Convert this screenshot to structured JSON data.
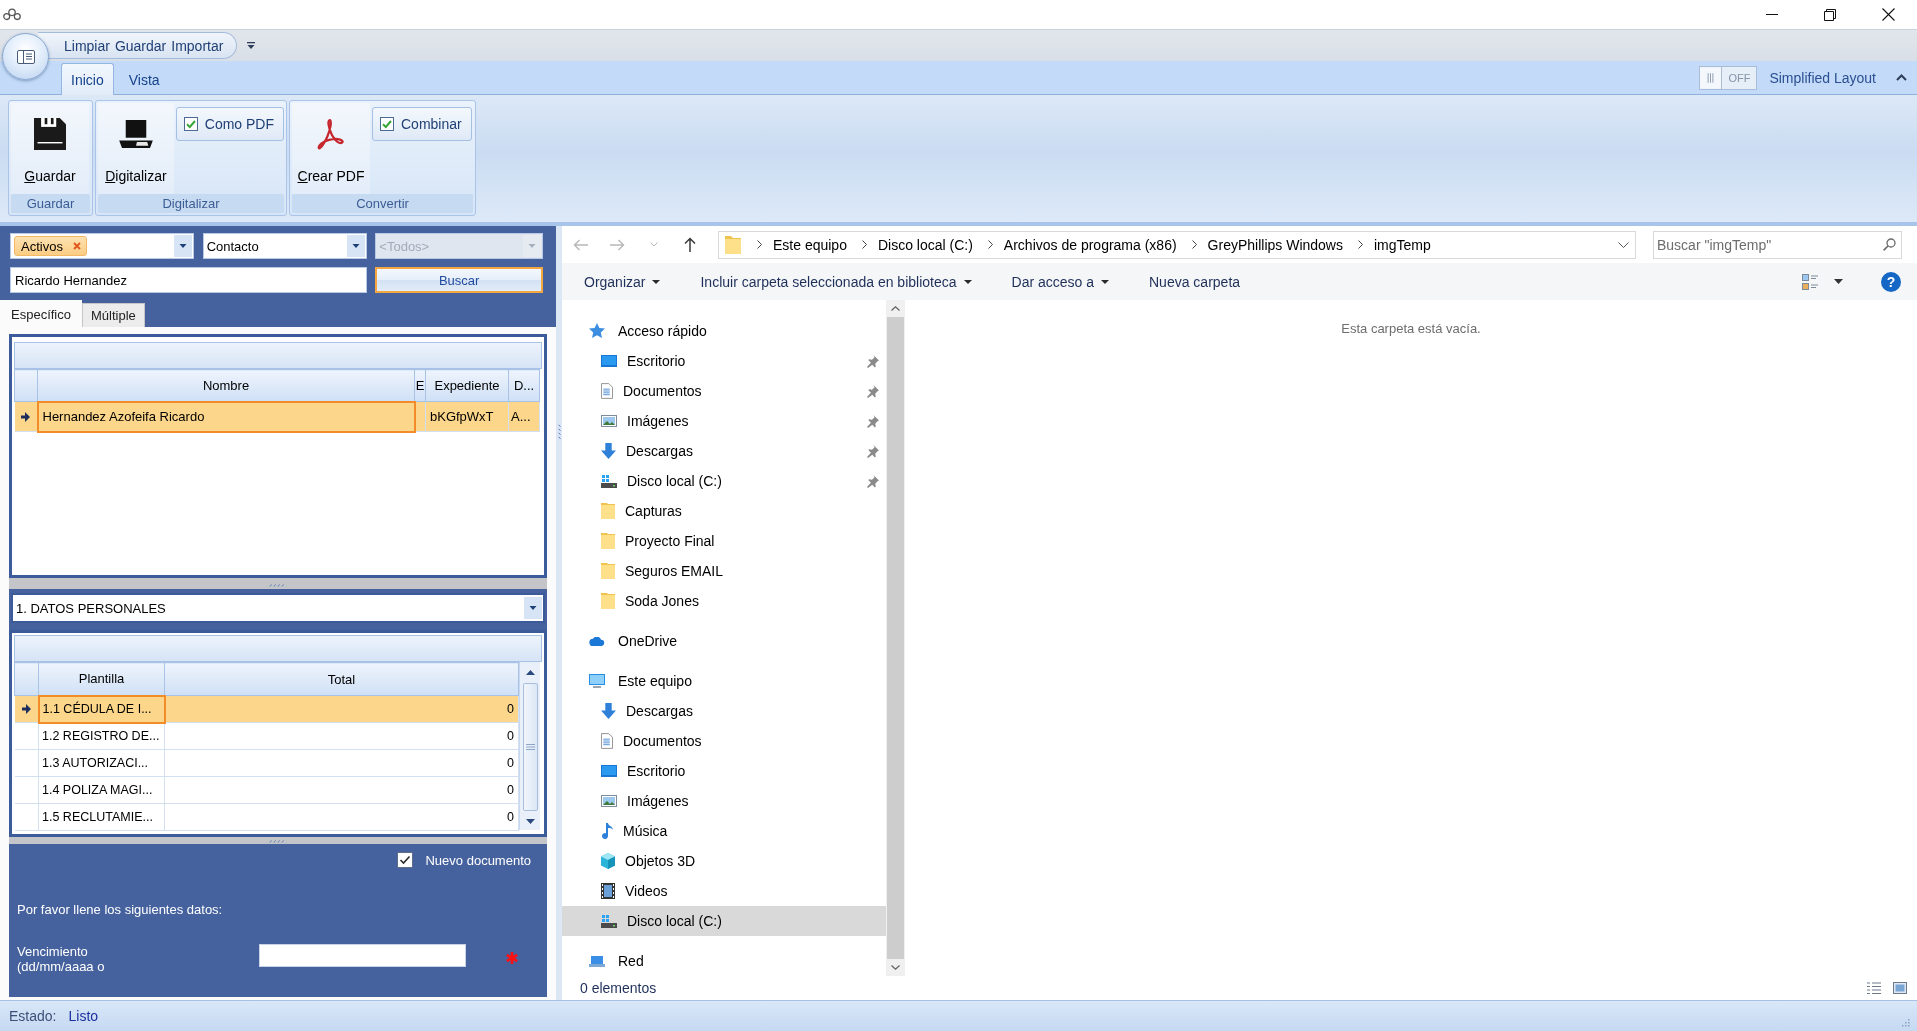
{
  "quick_access_toolbar": [
    "Limpiar",
    "Guardar",
    "Importar"
  ],
  "ribbon_tabs": [
    {
      "label": "Inicio",
      "selected": true
    },
    {
      "label": "Vista",
      "selected": false
    }
  ],
  "layout_switch": {
    "state_text": "OFF",
    "on": false,
    "label": "Simplified Layout"
  },
  "ribbon_groups": [
    {
      "label": "Guardar",
      "items": [
        {
          "kind": "large_button",
          "label": "Guardar"
        }
      ]
    },
    {
      "label": "Digitalizar",
      "items": [
        {
          "kind": "large_button",
          "label": "Digitalizar"
        },
        {
          "kind": "checkbox",
          "label": "Como PDF",
          "checked": true
        }
      ]
    },
    {
      "label": "Convertir",
      "items": [
        {
          "kind": "large_button",
          "label": "Crear PDF"
        },
        {
          "kind": "checkbox",
          "label": "Combinar",
          "checked": true
        }
      ]
    }
  ],
  "left_panel": {
    "status_filter": {
      "tags": [
        "Activos"
      ]
    },
    "type_filter": {
      "value": "Contacto"
    },
    "subtype_filter": {
      "value": "<Todos>",
      "disabled": true
    },
    "search_field": {
      "value": "Ricardo Hernandez"
    },
    "search_button": "Buscar",
    "tabs": [
      {
        "label": "Específico",
        "selected": true
      },
      {
        "label": "Múltiple",
        "selected": false
      }
    ],
    "results_table": {
      "columns": [
        "Nombre",
        "E",
        "Expediente",
        "D..."
      ],
      "rows": [
        {
          "selected": true,
          "cells": [
            "Hernandez Azofeifa Ricardo",
            null,
            "bKGfpWxT",
            "A..."
          ]
        }
      ]
    },
    "section_select": {
      "value": "1. DATOS PERSONALES"
    },
    "templates_table": {
      "columns": [
        "Plantilla",
        "Total"
      ],
      "rows": [
        {
          "selected": true,
          "cells": [
            "1.1 CÉDULA DE I...",
            "0"
          ]
        },
        {
          "selected": false,
          "cells": [
            "1.2 REGISTRO DE...",
            "0"
          ]
        },
        {
          "selected": false,
          "cells": [
            "1.3 AUTORIZACI...",
            "0"
          ]
        },
        {
          "selected": false,
          "cells": [
            "1.4 POLIZA MAGI...",
            "0"
          ]
        },
        {
          "selected": false,
          "cells": [
            "1.5 RECLUTAMIE...",
            "0"
          ]
        }
      ]
    },
    "new_document": {
      "label": "Nuevo documento",
      "checked": true
    },
    "form_prompt": "Por favor llene los siguientes datos:",
    "form_fields": [
      {
        "label": "Vencimiento (dd/mm/aaaa o",
        "required": true
      }
    ]
  },
  "explorer": {
    "nav_buttons": [
      {
        "kind": "back",
        "disabled": true
      },
      {
        "kind": "forward",
        "disabled": true
      },
      {
        "kind": "recent",
        "disabled": true
      },
      {
        "kind": "up",
        "disabled": false
      }
    ],
    "breadcrumb": [
      "Este equipo",
      "Disco local (C:)",
      "Archivos de programa (x86)",
      "GreyPhillips Windows",
      "imgTemp"
    ],
    "search": {
      "placeholder": "Buscar \"imgTemp\""
    },
    "commands": [
      {
        "label": "Organizar",
        "dropdown": true
      },
      {
        "label": "Incluir carpeta seleccionada en biblioteca",
        "dropdown": true
      },
      {
        "label": "Dar acceso a",
        "dropdown": true
      },
      {
        "label": "Nueva carpeta",
        "dropdown": false
      }
    ],
    "help_button": "?",
    "nav_tree": [
      {
        "kind": "quickaccess",
        "label": "Acceso rápido",
        "selected": false,
        "children": [
          {
            "kind": "desktop",
            "label": "Escritorio",
            "pinned": true,
            "selected": false
          },
          {
            "kind": "documents",
            "label": "Documentos",
            "pinned": true,
            "selected": false
          },
          {
            "kind": "pictures",
            "label": "Imágenes",
            "pinned": true,
            "selected": false
          },
          {
            "kind": "downloads",
            "label": "Descargas",
            "pinned": true,
            "selected": false
          },
          {
            "kind": "drive",
            "label": "Disco local (C:)",
            "pinned": true,
            "selected": false
          },
          {
            "kind": "folder",
            "label": "Capturas",
            "pinned": false,
            "selected": false
          },
          {
            "kind": "folder",
            "label": "Proyecto Final",
            "pinned": false,
            "selected": false
          },
          {
            "kind": "folder",
            "label": "Seguros EMAIL",
            "pinned": false,
            "selected": false
          },
          {
            "kind": "folder",
            "label": "Soda Jones",
            "pinned": false,
            "selected": false
          }
        ]
      },
      {
        "kind": "cloud",
        "label": "OneDrive",
        "selected": false
      },
      {
        "kind": "computer",
        "label": "Este equipo",
        "selected": false,
        "children": [
          {
            "kind": "downloads",
            "label": "Descargas",
            "pinned": false,
            "selected": false
          },
          {
            "kind": "documents",
            "label": "Documentos",
            "pinned": false,
            "selected": false
          },
          {
            "kind": "desktop",
            "label": "Escritorio",
            "pinned": false,
            "selected": false
          },
          {
            "kind": "pictures",
            "label": "Imágenes",
            "pinned": false,
            "selected": false
          },
          {
            "kind": "music",
            "label": "Música",
            "pinned": false,
            "selected": false
          },
          {
            "kind": "objects3d",
            "label": "Objetos 3D",
            "pinned": false,
            "selected": false
          },
          {
            "kind": "videos",
            "label": "Videos",
            "pinned": false,
            "selected": false
          },
          {
            "kind": "drive",
            "label": "Disco local (C:)",
            "pinned": false,
            "selected": true
          }
        ]
      },
      {
        "kind": "network",
        "label": "Red",
        "selected": false
      }
    ],
    "empty_message": "Esta carpeta está vacía.",
    "item_count": "0 elementos"
  },
  "status_bar": {
    "label": "Estado:",
    "value": "Listo"
  }
}
